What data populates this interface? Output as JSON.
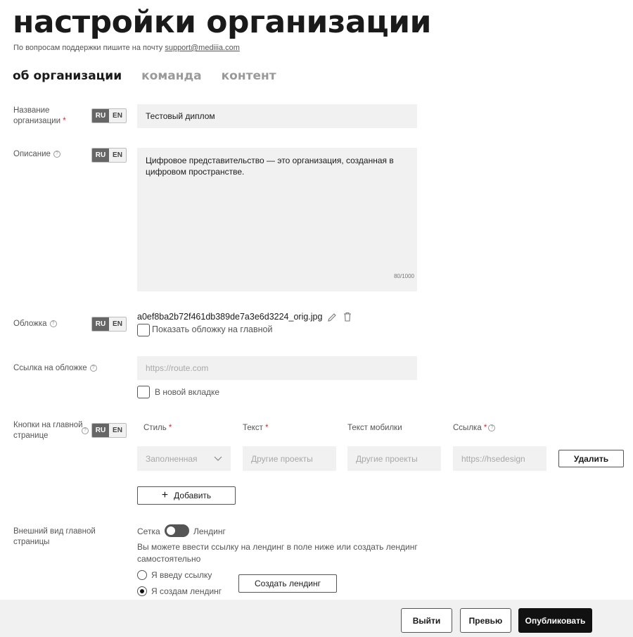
{
  "header": {
    "title": "настройки организации",
    "support_text": "По вопросам поддержки пишите на почту",
    "support_email": "support@mediiia.com"
  },
  "tabs": [
    {
      "label": "об организации",
      "active": true
    },
    {
      "label": "команда",
      "active": false
    },
    {
      "label": "контент",
      "active": false
    }
  ],
  "lang": {
    "ru": "RU",
    "en": "EN"
  },
  "org_name": {
    "label": "Название организации",
    "required_mark": "*",
    "value": "Тестовый диплом"
  },
  "description": {
    "label": "Описание",
    "value": "Цифровое представительство — это организация, созданная в цифровом пространстве.",
    "counter": "80/1000"
  },
  "cover": {
    "label": "Обложка",
    "filename": "a0ef8ba2b72f461db389de7a3e6d3224_orig.jpg",
    "show_on_main_label": "Показать обложку на главной"
  },
  "cover_link": {
    "label": "Ссылка на обложке",
    "placeholder": "https://route.com",
    "new_tab_label": "В новой вкладке"
  },
  "main_buttons": {
    "label": "Кнопки на главной странице",
    "columns": {
      "style": "Стиль",
      "text": "Текст",
      "text_mobile": "Текст мобилки",
      "link": "Ссылка"
    },
    "row": {
      "style": "Заполненная",
      "text": "Другие проекты",
      "text_mobile": "Другие проекты",
      "link": "https://hsedesign",
      "delete_label": "Удалить"
    },
    "add_label": "Добавить"
  },
  "appearance": {
    "label": "Внешний вид главной страницы",
    "toggle_left": "Сетка",
    "toggle_right": "Лендинг",
    "hint": "Вы можете ввести ссылку на лендинг в поле ниже или создать лендинг самостоятельно",
    "radio_link": "Я введу ссылку",
    "radio_create": "Я создам лендинг",
    "create_button": "Создать лендинг"
  },
  "footer": {
    "exit": "Выйти",
    "preview": "Превью",
    "publish": "Опубликовать"
  },
  "colors": {
    "accent": "#111111",
    "required": "#d9263b",
    "field_bg": "#f1f1f1"
  }
}
